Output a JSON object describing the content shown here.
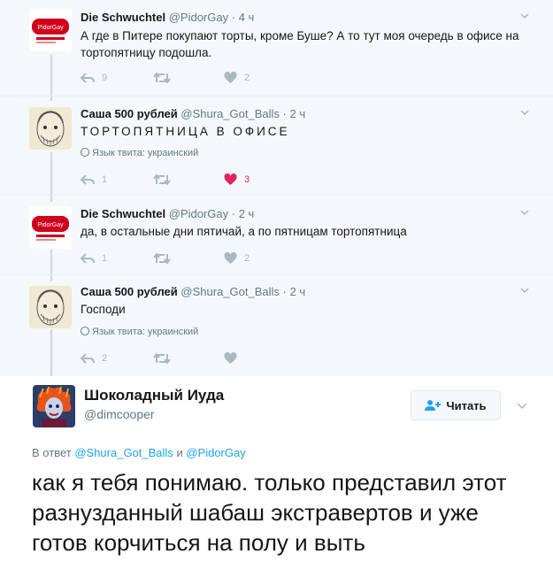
{
  "thread": [
    {
      "name": "Die Schwuchtel",
      "handle": "@PidorGay",
      "time": "4 ч",
      "text": "А где в Питере покупают торты, кроме Буше? А то тут моя очередь в офисе на тортопятницу подошла.",
      "avatar_text": "PidorGay",
      "replies": "9",
      "retweets": "",
      "likes": "2",
      "liked": false
    },
    {
      "name": "Саша 500 рублей",
      "handle": "@Shura_Got_Balls",
      "time": "2 ч",
      "text": "ТОРТОПЯТНИЦА В ОФИСЕ",
      "lang_label": "Язык твита: украинский",
      "replies": "1",
      "retweets": "",
      "likes": "3",
      "liked": true
    },
    {
      "name": "Die Schwuchtel",
      "handle": "@PidorGay",
      "time": "2 ч",
      "text": "да, в остальные дни пятичай, а по пятницам тортопятница",
      "avatar_text": "PidorGay",
      "replies": "1",
      "retweets": "",
      "likes": "2",
      "liked": false
    },
    {
      "name": "Саша 500 рублей",
      "handle": "@Shura_Got_Balls",
      "time": "2 ч",
      "text": "Господи",
      "lang_label": "Язык твита: украинский",
      "replies": "2",
      "retweets": "",
      "likes": "",
      "liked": false
    }
  ],
  "main": {
    "name": "Шоколадный Иуда",
    "handle": "@dimcooper",
    "follow_label": "Читать",
    "reply_prefix": "В ответ",
    "reply_user1": "@Shura_Got_Balls",
    "reply_and": "и",
    "reply_user2": "@PidorGay",
    "text": "как я тебя понимаю. только представил этот разнузданный шабаш экстравертов и уже готов корчиться на полу и выть"
  },
  "colors": {
    "thread_bg": "#f5f8fa",
    "icon_gray": "#aab8c2",
    "like_red": "#e0245e",
    "link_blue": "#1da1f2"
  }
}
